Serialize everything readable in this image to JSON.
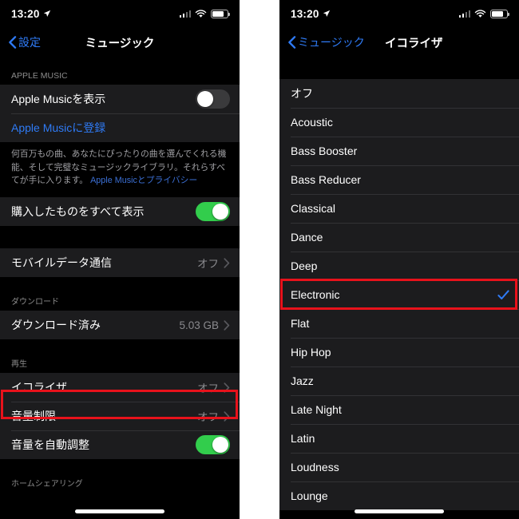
{
  "status_bar": {
    "time": "13:20",
    "location_icon": "location-arrow-icon",
    "signal_icon": "cellular-signal-icon",
    "wifi_icon": "wifi-icon",
    "battery_icon": "battery-icon"
  },
  "colors": {
    "accent_blue": "#2f7bf6",
    "toggle_on_green": "#32cd4c",
    "toggle_off_gray": "#3a3a3c",
    "annotation_red": "#e8121b",
    "row_background": "#1c1c1e",
    "screen_background": "#000000",
    "secondary_text": "#8a8a8e"
  },
  "left_screen": {
    "nav": {
      "back_label": "設定",
      "title": "ミュージック",
      "back_icon": "chevron-left-icon"
    },
    "sections": [
      {
        "header": "APPLE MUSIC",
        "rows": [
          {
            "label": "Apple Musicを表示",
            "control": "toggle",
            "toggle_on": false
          },
          {
            "label": "Apple Musicに登録",
            "control": "link"
          }
        ],
        "footnote": {
          "text": "何百万もの曲、あなたにぴったりの曲を選んでくれる機能、そして完璧なミュージックライブラリ。それらすべてが手に入ります。 ",
          "link": "Apple Musicとプライバシー"
        }
      },
      {
        "header": "",
        "rows": [
          {
            "label": "購入したものをすべて表示",
            "control": "toggle",
            "toggle_on": true
          }
        ]
      },
      {
        "header": "",
        "rows": [
          {
            "label": "モバイルデータ通信",
            "control": "disclosure",
            "value": "オフ"
          }
        ]
      },
      {
        "header": "ダウンロード",
        "rows": [
          {
            "label": "ダウンロード済み",
            "control": "disclosure",
            "value": "5.03 GB"
          }
        ]
      },
      {
        "header": "再生",
        "rows": [
          {
            "label": "イコライザ",
            "control": "disclosure",
            "value": "オフ",
            "highlighted": true
          },
          {
            "label": "音量制限",
            "control": "disclosure",
            "value": "オフ"
          },
          {
            "label": "音量を自動調整",
            "control": "toggle",
            "toggle_on": true
          }
        ]
      },
      {
        "header": "ホームシェアリング",
        "rows": []
      }
    ]
  },
  "right_screen": {
    "nav": {
      "back_label": "ミュージック",
      "title": "イコライザ",
      "back_icon": "chevron-left-icon"
    },
    "eq_presets": [
      {
        "label": "オフ",
        "selected": false
      },
      {
        "label": "Acoustic",
        "selected": false
      },
      {
        "label": "Bass Booster",
        "selected": false
      },
      {
        "label": "Bass Reducer",
        "selected": false
      },
      {
        "label": "Classical",
        "selected": false
      },
      {
        "label": "Dance",
        "selected": false
      },
      {
        "label": "Deep",
        "selected": false
      },
      {
        "label": "Electronic",
        "selected": true,
        "highlighted": true
      },
      {
        "label": "Flat",
        "selected": false
      },
      {
        "label": "Hip Hop",
        "selected": false
      },
      {
        "label": "Jazz",
        "selected": false
      },
      {
        "label": "Late Night",
        "selected": false
      },
      {
        "label": "Latin",
        "selected": false
      },
      {
        "label": "Loudness",
        "selected": false
      },
      {
        "label": "Lounge",
        "selected": false
      }
    ],
    "checkmark_icon": "checkmark-icon"
  }
}
